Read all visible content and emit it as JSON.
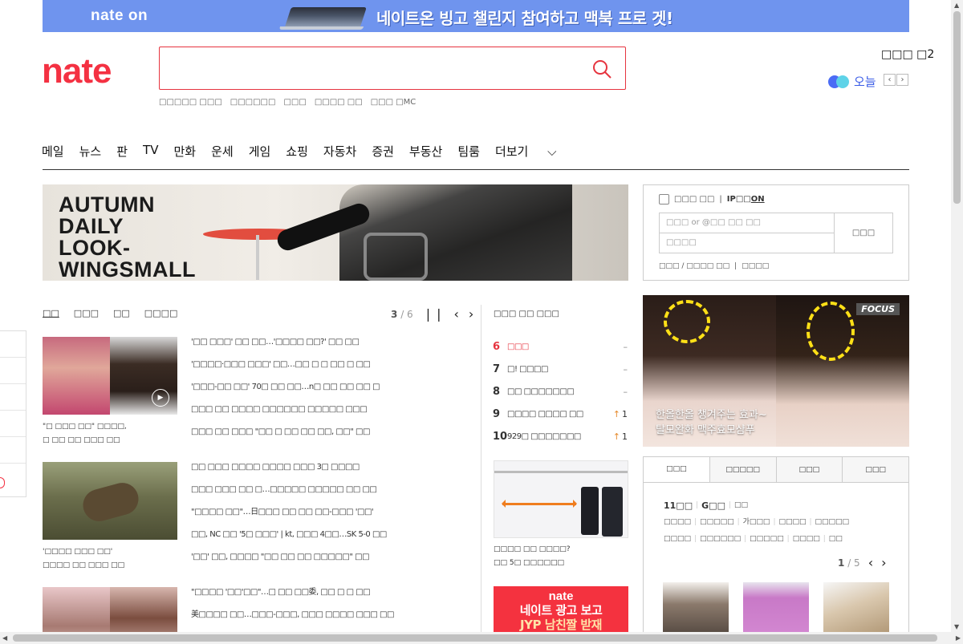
{
  "top_ad": {
    "logo": "nate on",
    "text": "네이트온 빙고 챌린지 참여하고 맥북 프로 겟!"
  },
  "header": {
    "logo": "nate",
    "search_value": "",
    "keywords": [
      "□□□□□ □□□",
      "□□□□□□",
      "□□□",
      "□□□□ □□",
      "□□□ □MC"
    ],
    "weather_label": "□□□ □2",
    "today_label": "오늘"
  },
  "nav": [
    "메일",
    "뉴스",
    "판",
    "TV",
    "만화",
    "운세",
    "게임",
    "쇼핑",
    "자동차",
    "증권",
    "부동산",
    "팀룸",
    "더보기"
  ],
  "main_banner": {
    "lines": [
      "AUTUMN",
      "DAILY",
      "LOOK-",
      "WINGSMALL"
    ]
  },
  "login": {
    "keep_label": "□□□ □□",
    "ip_label": "IP□□",
    "ip_state": "ON",
    "id_placeholder": "□□□ or @□□ □□ □□",
    "pw_placeholder": "□□□□",
    "login_button": "□□□",
    "links": [
      "□□□ / □□□□ □□",
      "□□□□"
    ]
  },
  "news": {
    "tabs": [
      "□□",
      "□□□",
      "□□",
      "□□□□"
    ],
    "page_current": "3",
    "page_total": "/ 6",
    "blocks": [
      {
        "caption": [
          "\"□ □□□ □□\" □□□□,",
          "□ □□ □□ □□□ □□"
        ],
        "headlines": [
          "'□□ □□□' □□ □□…'□□□□ □□?' □□ □□",
          "'□□□□·□□□ □□□' □□…□□ □ □ □□ □ □□",
          "'□□□-□□ □□' 70□ □□ □□…n□ □□ □□ □□ □",
          "□□□ □□ □□□□ □□□□□□ □□□□□ □□□",
          "□□□ □□ □□□ \"□□ □ □□ □□ □□, □□\" □□"
        ]
      },
      {
        "caption": [
          "'□□□□ □□□ □□'",
          "□□□□ □□ □□□ □□"
        ],
        "headlines": [
          "□□ □□□ □□□□ □□□□ □□□ 3□ □□□□",
          "□□□ □□□ □□ □…□□□□□ □□□□□ □□ □□",
          "\"□□□□ □□\"…日□□□ □□ □□ □□-□□□ '□□'",
          "□□, NC □□ '5□ □□□'  |  kt, □□□ 4□□…SK 5-0 □□",
          "'□□' □□, □□□□ \"□□ □□ □□ □□□□□\" □□"
        ]
      },
      {
        "caption": [],
        "headlines": [
          "\"□□□□ '□□'□□\"…□ □□ □□委, □□ □ □ □□",
          "美□□□□ □□…□□□-□□□, □□□ □□□□ □□□ □□"
        ]
      }
    ]
  },
  "ranking": {
    "title": "□□□ □□ □□□",
    "items": [
      {
        "num": "6",
        "text": "□□□",
        "change": "–",
        "hot": true
      },
      {
        "num": "7",
        "text": "□! □□□□",
        "change": "–",
        "hot": false
      },
      {
        "num": "8",
        "text": "□□ □□□□□□□",
        "change": "–",
        "hot": false
      },
      {
        "num": "9",
        "text": "□□□□ □□□□ □□",
        "change": "1",
        "hot": false,
        "up": true
      },
      {
        "num": "10",
        "text": "929□ □□□□□□□",
        "change": "1",
        "hot": false,
        "up": true
      }
    ]
  },
  "rack_ad": {
    "caption": [
      "□□□□ □□ □□□□?",
      "□□ 5□ □□□□□□"
    ]
  },
  "nate_ad": {
    "logo": "nate",
    "line1": "네이트 광고 보고",
    "line2": "JYP 남친짤 받재"
  },
  "focus_ad": {
    "badge": "FOCUS",
    "line1": "한올한올 챙겨주는 효과~",
    "line2": "탈모완화 맥주효모샴푸"
  },
  "shop": {
    "tabs": [
      "□□□",
      "□□□□□",
      "□□□",
      "□□□"
    ],
    "row1": [
      "11□□",
      "G□□",
      "□□"
    ],
    "row2": [
      "□□□□",
      "□□□□□",
      "가□□□",
      "□□□□",
      "□□□□□"
    ],
    "row3": [
      "□□□□",
      "□□□□□□",
      "□□□□□",
      "□□□□",
      "□□"
    ],
    "page_current": "1",
    "page_total": "/ 5"
  },
  "colors": {
    "brand_red": "#f43142",
    "ad_blue": "#6f94ee",
    "today_blue": "#3b5de7"
  }
}
